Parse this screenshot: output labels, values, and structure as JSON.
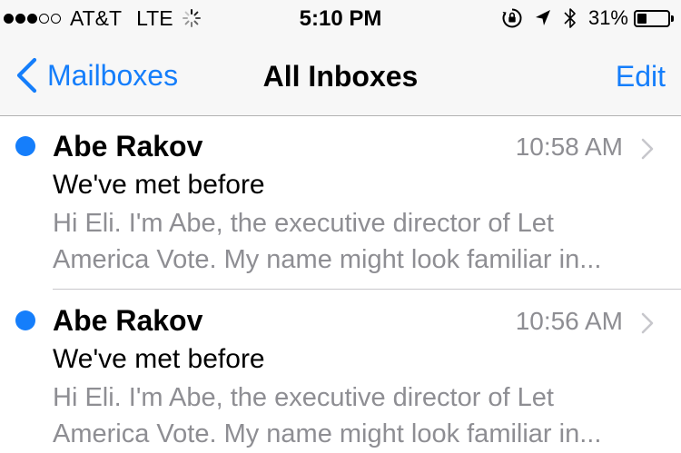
{
  "status_bar": {
    "signal_bars_filled": 3,
    "signal_bars_total": 5,
    "carrier": "AT&T",
    "network": "LTE",
    "time": "5:10 PM",
    "battery_percent": "31%",
    "battery_level": 0.31,
    "icons": [
      "activity-spinner-icon",
      "orientation-lock-icon",
      "location-arrow-icon",
      "bluetooth-icon",
      "battery-icon"
    ]
  },
  "nav": {
    "back_label": "Mailboxes",
    "title": "All Inboxes",
    "edit_label": "Edit",
    "accent_color": "#157efb"
  },
  "messages": [
    {
      "sender": "Abe Rakov",
      "time": "10:58 AM",
      "subject": "We've met before",
      "preview_line1": "Hi Eli. I'm Abe, the executive director of Let",
      "preview_line2": "America Vote. My name might look familiar in...",
      "unread": true
    },
    {
      "sender": "Abe Rakov",
      "time": "10:56 AM",
      "subject": "We've met before",
      "preview_line1": "Hi Eli. I'm Abe, the executive director of Let",
      "preview_line2": "America Vote. My name might look familiar in...",
      "unread": true
    }
  ]
}
